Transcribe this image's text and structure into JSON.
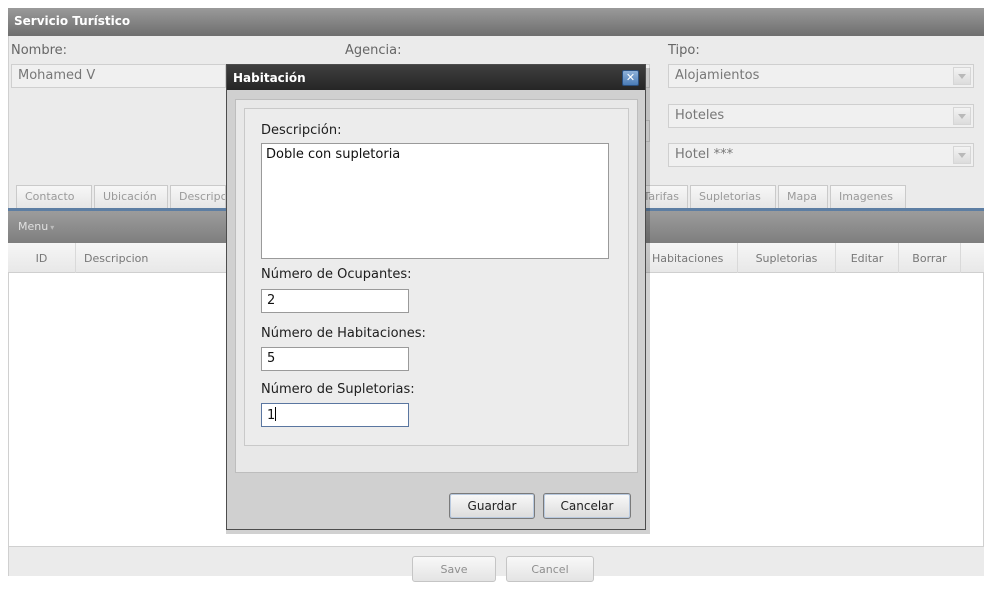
{
  "panel": {
    "title": "Servicio Turístico"
  },
  "form": {
    "nombre_label": "Nombre:",
    "nombre_value": "Mohamed V",
    "agencia_label": "Agencia:",
    "tipo_label": "Tipo:",
    "tipo_values": [
      "Alojamientos",
      "Hoteles",
      "Hotel ***"
    ]
  },
  "tabs": {
    "left": [
      "Contacto",
      "Ubicación",
      "Descripción"
    ],
    "right": [
      "Tarifas",
      "Supletorias",
      "Mapa",
      "Imagenes"
    ]
  },
  "menu": {
    "label": "Menu",
    "arrow": "▾"
  },
  "grid": {
    "columns_left": [
      "ID",
      "Descripcion"
    ],
    "columns_right": [
      "Habitaciones",
      "Supletorias",
      "Editar",
      "Borrar"
    ]
  },
  "footer": {
    "save": "Save",
    "cancel": "Cancel"
  },
  "dialog": {
    "title": "Habitación",
    "close_glyph": "✕",
    "descripcion_label": "Descripción:",
    "descripcion_value": "Doble con supletoria",
    "ocupantes_label": "Número de Ocupantes:",
    "ocupantes_value": "2",
    "habitaciones_label": "Número de Habitaciones:",
    "habitaciones_value": "5",
    "supletorias_label": "Número de Supletorias:",
    "supletorias_value": "1",
    "guardar": "Guardar",
    "cancelar": "Cancelar"
  }
}
